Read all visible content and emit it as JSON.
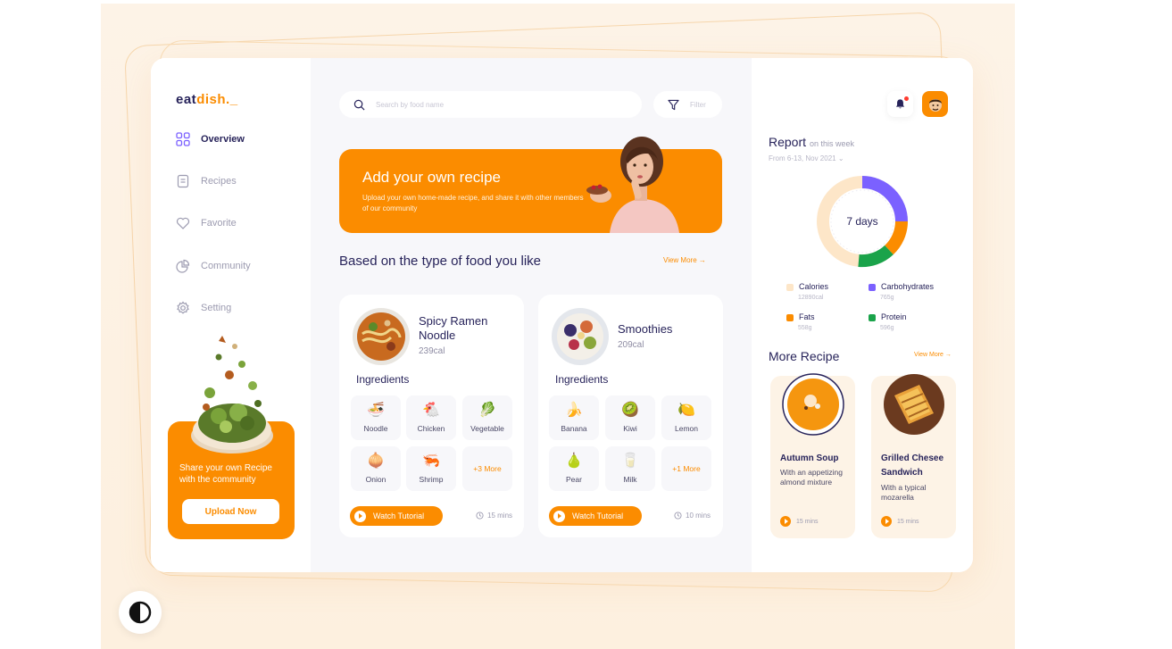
{
  "brand": {
    "logo_a": "eat",
    "logo_b": "dish._"
  },
  "nav": [
    {
      "label": "Overview",
      "icon": "grid-icon"
    },
    {
      "label": "Recipes",
      "icon": "document-icon"
    },
    {
      "label": "Favorite",
      "icon": "heart-icon"
    },
    {
      "label": "Community",
      "icon": "pie-icon"
    },
    {
      "label": "Setting",
      "icon": "gear-icon"
    }
  ],
  "share": {
    "text": "Share your own Recipe with the community",
    "button": "Upload Now"
  },
  "search": {
    "placeholder": "Search by food name"
  },
  "filter": {
    "label": "Filter"
  },
  "banner": {
    "title": "Add your own recipe",
    "subtitle": "Upload your own home-made recipe, and share it with other members of our community"
  },
  "section": {
    "title": "Based on the type of food you like",
    "view_more": "View More"
  },
  "recipes": [
    {
      "name": "Spicy Ramen Noodle",
      "calories": "239cal",
      "ingredients_title": "Ingredients",
      "ingredients": [
        "Noodle",
        "Chicken",
        "Vegetable",
        "Onion",
        "Shrimp"
      ],
      "more": "+3 More",
      "watch": "Watch Tutorial",
      "time": "15 mins"
    },
    {
      "name": "Smoothies",
      "calories": "209cal",
      "ingredients_title": "Ingredients",
      "ingredients": [
        "Banana",
        "Kiwi",
        "Lemon",
        "Pear",
        "Milk"
      ],
      "more": "+1 More",
      "watch": "Watch Tutorial",
      "time": "10 mins"
    }
  ],
  "report": {
    "title": "Report",
    "period": "on this week",
    "date_range": "From 6-13, Nov 2021",
    "center": "7 days",
    "legend": [
      {
        "label": "Calories",
        "value": "12890cal",
        "color": "#fde6c8"
      },
      {
        "label": "Carbohydrates",
        "value": "765g",
        "color": "#7b61ff"
      },
      {
        "label": "Fats",
        "value": "558g",
        "color": "#fb8c00"
      },
      {
        "label": "Protein",
        "value": "596g",
        "color": "#1aa34a"
      }
    ]
  },
  "more_recipe": {
    "title": "More Recipe",
    "view_more": "View More",
    "items": [
      {
        "name": "Autumn Soup",
        "desc": "With an appetizing almond mixture",
        "time": "15 mins"
      },
      {
        "name": "Grilled Chesee Sandwich",
        "desc": "With a typical mozarella",
        "time": "15 mins"
      }
    ]
  },
  "colors": {
    "accent": "#fb8c00",
    "text": "#27235a",
    "muted": "#9c9bb0"
  }
}
